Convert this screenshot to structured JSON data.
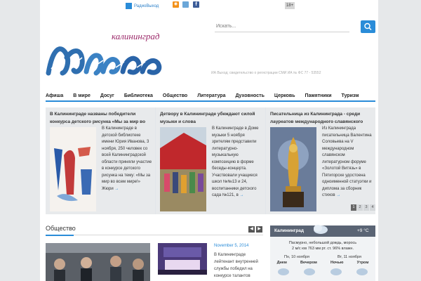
{
  "topbar": {
    "radio_label": "РадиоВыход",
    "age_badge": "18+"
  },
  "logo": {
    "city": "калининград",
    "script": "Выход"
  },
  "search": {
    "placeholder": "Искать..."
  },
  "registration": "ИА Выход; свидетельство о регистрации СМИ ИА № ФС 77 - 53552",
  "nav": [
    "Афиша",
    "В мире",
    "Досуг",
    "Библиотека",
    "Общество",
    "Литература",
    "Духовность",
    "Церковь",
    "Памятники",
    "Туризм"
  ],
  "slides": [
    {
      "title": "В Калининграде названы победители конкурса детского рисунка «Мы за мир во",
      "text": "В Калининграде в детской библиотеке имени Юрия Иванова, 3 ноября, 250 человек со всей Калининградской области приняли участие в конкурсе детского рисунка на тему: «Мы за мир во всем мире!» Жюри",
      "more": "→"
    },
    {
      "title": "Детвору в Калининграде убеждают силой музыки и слова",
      "text": "В Калининграде в Доме музыки 5 ноября зрителям представили литературно-музыкальную композицию в форме беседы-концерта. Участвовали учащиеся школ №№13 и 24, воспитанники детского сада №121, в",
      "more": "→"
    },
    {
      "title": "Писательница из Калининграда - среди лауреатов международного славянского",
      "text": "Из Калининграда писательница Валентина Соловьева на V международном славянском литературном форуме «Золотой Витязь» в Пятигорске удостоена одноименной статуэтки и диплома за сборник стихов",
      "more": "→"
    }
  ],
  "pager": [
    "1",
    "2",
    "3",
    "4"
  ],
  "section": {
    "title": "Общество",
    "prev": "◀",
    "next": "▶"
  },
  "news2": {
    "date": "November 5, 2014",
    "text": "В Калининграде лейтенант внутренней службы победил на конкурсе талантов"
  },
  "weather": {
    "city": "Калининград",
    "temp": "+9 °C",
    "desc_line1": "Пасмурно, небольшой дождь, морось",
    "desc_line2": "2 м/с  юв   763 мм рт. ст.  96% влажн.",
    "days": [
      "Пн, 10 ноября",
      "Вт, 11 ноября"
    ],
    "parts": [
      "Днем",
      "Вечером",
      "Ночью",
      "Утром"
    ]
  },
  "colors": {
    "accent": "#2a8cd8",
    "logo_city": "#9c2a6a"
  }
}
